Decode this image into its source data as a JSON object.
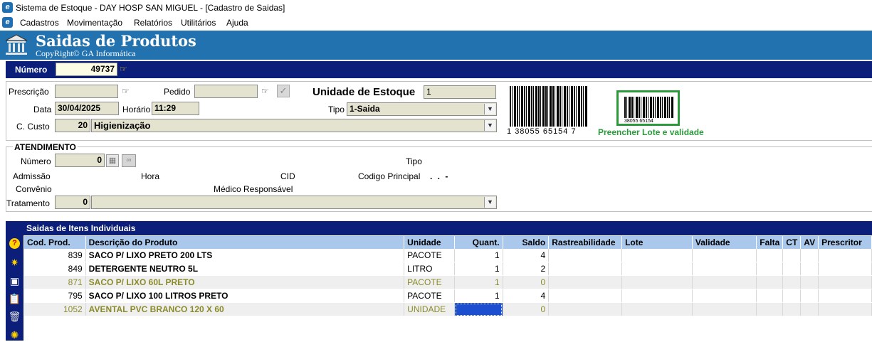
{
  "window": {
    "title": "Sistema de Estoque - DAY HOSP SAN MIGUEL - [Cadastro de Saidas]"
  },
  "menu": [
    "Cadastros",
    "Movimentação",
    "Relatórios",
    "Utilitários",
    "Ajuda"
  ],
  "header": {
    "title": "Saidas de Produtos",
    "subtitle": "CopyRight© GA Informática"
  },
  "numero": {
    "label": "Número",
    "value": "49737"
  },
  "form": {
    "prescricao_label": "Prescrição",
    "prescricao_value": "",
    "pedido_label": "Pedido",
    "pedido_value": "",
    "unidade_label": "Unidade de Estoque",
    "unidade_value": "1",
    "data_label": "Data",
    "data_value": "30/04/2025",
    "horario_label": "Horário",
    "horario_value": "11:29",
    "tipo_label": "Tipo",
    "tipo_value": "1-Saida",
    "custo_label": "C. Custo",
    "custo_code": "20",
    "custo_desc": "Higienização"
  },
  "barcode": {
    "number": "38055 65154",
    "prefix": "1",
    "suffix": "7",
    "note": "Preencher Lote e validade"
  },
  "atendimento": {
    "title": "ATENDIMENTO",
    "numero_label": "Número",
    "numero_value": "0",
    "tipo_label": "Tipo",
    "admissao_label": "Admissão",
    "hora_label": "Hora",
    "cid_label": "CID",
    "codigo_label": "Codigo Principal",
    "codigo_value": ". . -",
    "convenio_label": "Convênio",
    "medico_label": "Médico Responsável",
    "tratamento_label": "Tratamento",
    "tratamento_value": "0"
  },
  "grid": {
    "title": "Saidas de Itens Individuais",
    "columns": [
      "Cod. Prod.",
      "Descrição do Produto",
      "Unidade",
      "Quant.",
      "Saldo",
      "Rastreabilidade",
      "Lote",
      "Validade",
      "Falta",
      "CT",
      "AV",
      "Prescritor"
    ],
    "rows": [
      {
        "cod": "839",
        "desc": "SACO P/ LIXO PRETO 200 LTS",
        "unidade": "PACOTE",
        "quant": "1",
        "saldo": "4"
      },
      {
        "cod": "849",
        "desc": "DETERGENTE NEUTRO 5L",
        "unidade": "LITRO",
        "quant": "1",
        "saldo": "2"
      },
      {
        "cod": "871",
        "desc": "SACO P/ LIXO 60L PRETO",
        "unidade": "PACOTE",
        "quant": "1",
        "saldo": "0"
      },
      {
        "cod": "795",
        "desc": "SACO P/ LIXO 100 LITROS PRETO",
        "unidade": "PACOTE",
        "quant": "1",
        "saldo": "4"
      },
      {
        "cod": "1052",
        "desc": "AVENTAL PVC BRANCO 120 X 60",
        "unidade": "UNIDADE",
        "quant": "",
        "saldo": "0"
      }
    ]
  },
  "colors": {
    "header_blue": "#2272b0",
    "navy": "#0b1f7a",
    "grid_header": "#a9c8ec",
    "zero_stock_text": "#8b8b2a",
    "note_green": "#2a9a3a"
  }
}
